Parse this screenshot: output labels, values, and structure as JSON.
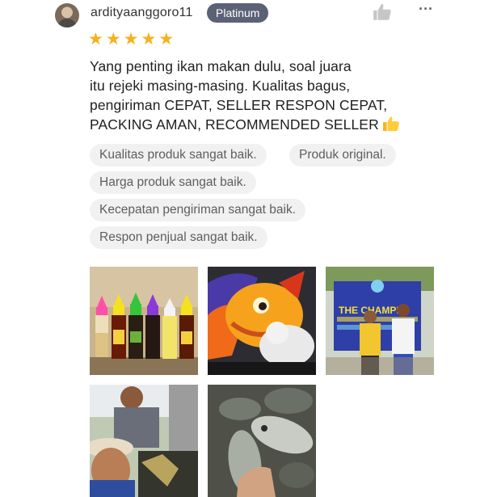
{
  "review": {
    "username": "ardityaanggoro11",
    "badge": "Platinum",
    "rating": 5,
    "text_lines": [
      "Yang penting ikan makan dulu, soal juara",
      "itu rejeki masing-masing. Kualitas bagus,",
      "pengiriman CEPAT, SELLER RESPON CEPAT,",
      "PACKING AMAN, RECOMMENDED SELLER"
    ],
    "tags": [
      "Kualitas produk sangat baik.",
      "Produk original.",
      "Harga produk sangat baik.",
      "Kecepatan pengiriman sangat baik.",
      "Respon penjual sangat baik."
    ],
    "banner_text": "THE CHAMPI"
  },
  "icons": {
    "like": "thumbs-up-icon",
    "more": "more-horizontal-icon",
    "star": "star-icon"
  },
  "colors": {
    "badge_bg": "#5b6275",
    "star": "#f6b11d",
    "tag_bg": "#f1f1f1"
  }
}
